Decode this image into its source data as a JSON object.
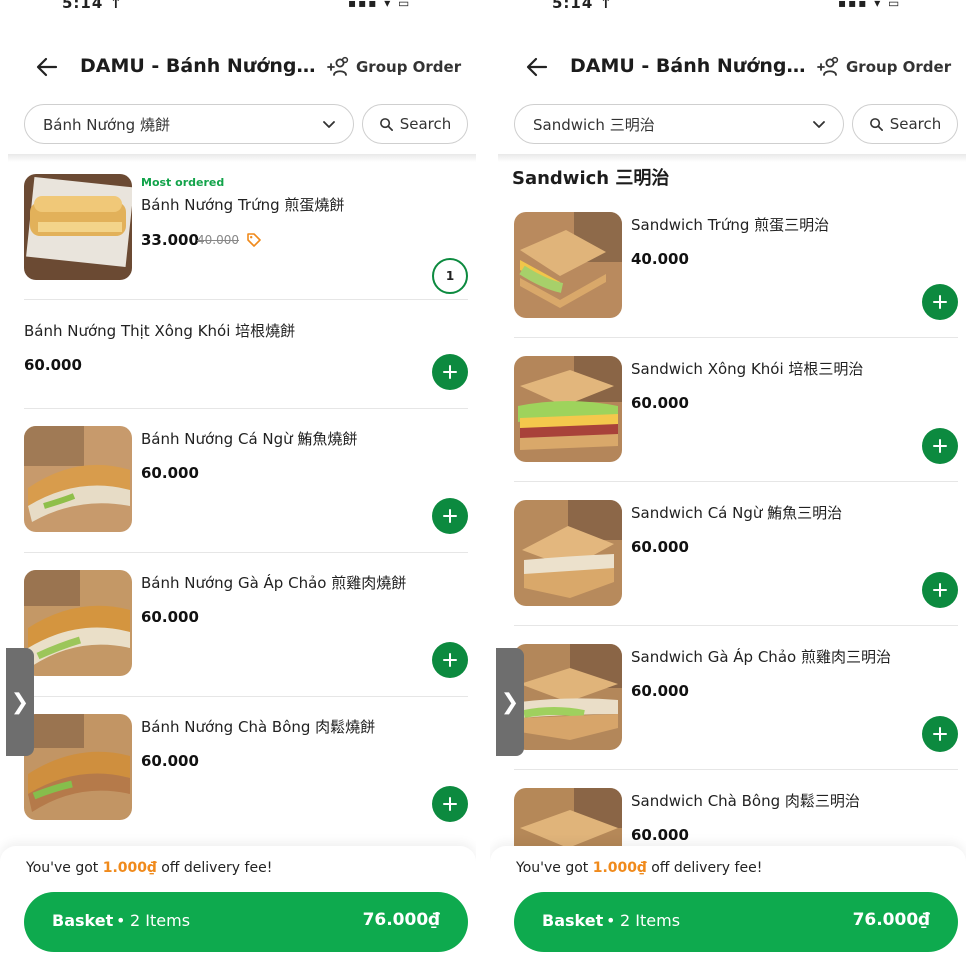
{
  "colors": {
    "brand_green": "#0eaa4e",
    "add_green": "#0c8a3f",
    "promo_orange": "#f08a1c",
    "badge_green": "#12a34a"
  },
  "status": {
    "time": "5:14 ↑",
    "icons": "signal-wifi-battery"
  },
  "screens": [
    {
      "header": {
        "title": "DAMU - Bánh Nướng...",
        "group_order": "Group Order"
      },
      "category_select": {
        "value": "Bánh Nướng 燒餅",
        "icon": "chevron-down-icon"
      },
      "search": {
        "label": "Search"
      },
      "section_title": "",
      "items": [
        {
          "badge": "Most ordered",
          "name": "Bánh Nướng Trứng 煎蛋燒餅",
          "price": "33.000",
          "old_price": "40.000",
          "qty": "1",
          "has_image": true
        },
        {
          "badge": "",
          "name": "Bánh Nướng Thịt Xông Khói 培根燒餅",
          "price": "60.000",
          "old_price": "",
          "qty": "",
          "has_image": false
        },
        {
          "badge": "",
          "name": "Bánh Nướng Cá Ngừ 鮪魚燒餅",
          "price": "60.000",
          "old_price": "",
          "qty": "",
          "has_image": true
        },
        {
          "badge": "",
          "name": "Bánh Nướng Gà Áp Chảo 煎雞肉燒餅",
          "price": "60.000",
          "old_price": "",
          "qty": "",
          "has_image": true
        },
        {
          "badge": "",
          "name": "Bánh Nướng Chà Bông 肉鬆燒餅",
          "price": "60.000",
          "old_price": "",
          "qty": "",
          "has_image": true
        }
      ],
      "side_tab": "❯",
      "promo": {
        "prefix": "You've got ",
        "amount": "1.000₫",
        "suffix": " off delivery fee!"
      },
      "basket": {
        "label": "Basket",
        "dot": "•",
        "count": "2 Items",
        "total": "76.000₫"
      }
    },
    {
      "header": {
        "title": "DAMU - Bánh Nướng...",
        "group_order": "Group Order"
      },
      "category_select": {
        "value": "Sandwich 三明治",
        "icon": "chevron-down-icon"
      },
      "search": {
        "label": "Search"
      },
      "section_title": "Sandwich 三明治",
      "items": [
        {
          "badge": "",
          "name": "Sandwich Trứng 煎蛋三明治",
          "price": "40.000",
          "old_price": "",
          "qty": "",
          "has_image": true
        },
        {
          "badge": "",
          "name": "Sandwich Xông Khói  培根三明治",
          "price": "60.000",
          "old_price": "",
          "qty": "",
          "has_image": true
        },
        {
          "badge": "",
          "name": "Sandwich Cá Ngừ 鮪魚三明治",
          "price": "60.000",
          "old_price": "",
          "qty": "",
          "has_image": true
        },
        {
          "badge": "",
          "name": "Sandwich Gà Áp Chảo 煎雞肉三明治",
          "price": "60.000",
          "old_price": "",
          "qty": "",
          "has_image": true
        },
        {
          "badge": "",
          "name": "Sandwich Chà Bông 肉鬆三明治",
          "price": "60.000",
          "old_price": "",
          "qty": "",
          "has_image": true
        }
      ],
      "side_tab": "❯",
      "promo": {
        "prefix": "You've got ",
        "amount": "1.000₫",
        "suffix": " off delivery fee!"
      },
      "basket": {
        "label": "Basket",
        "dot": "•",
        "count": "2 Items",
        "total": "76.000₫"
      }
    }
  ]
}
